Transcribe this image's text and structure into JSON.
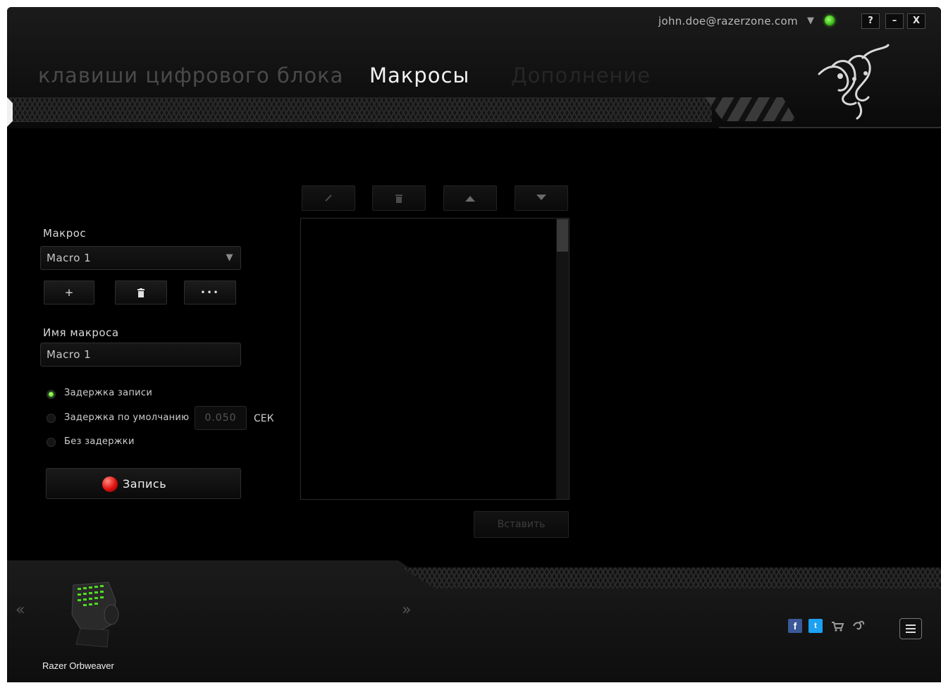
{
  "header": {
    "account_email": "john.doe@razerzone.com",
    "window_buttons": {
      "help": "?",
      "minimize": "–",
      "close": "X"
    },
    "tabs": [
      {
        "label": "клавиши цифрового блока",
        "state": "inactive"
      },
      {
        "label": "Макросы",
        "state": "active"
      },
      {
        "label": "Дополнение",
        "state": "faint"
      }
    ]
  },
  "macro_panel": {
    "macro_label": "Макрос",
    "macro_selected": "Macro 1",
    "buttons": {
      "add": "+",
      "more": "•••"
    },
    "name_label": "Имя макроса",
    "name_value": "Macro 1",
    "delay_options": [
      {
        "label": "Задержка записи",
        "selected": true
      },
      {
        "label": "Задержка по умолчанию",
        "selected": false
      },
      {
        "label": "Без задержки",
        "selected": false
      }
    ],
    "default_delay_value": "0.050",
    "delay_unit": "СЕК",
    "record_label": "Запись"
  },
  "editor": {
    "insert_label": "Вставить"
  },
  "footer": {
    "device_name": "Razer Orbweaver",
    "prev_arrow": "«",
    "next_arrow": "»",
    "social_icons": [
      "facebook-icon",
      "twitter-icon",
      "cart-icon",
      "razer-icon"
    ]
  },
  "colors": {
    "accent_green": "#44d62c",
    "record_red": "#e01010",
    "background": "#000000"
  }
}
